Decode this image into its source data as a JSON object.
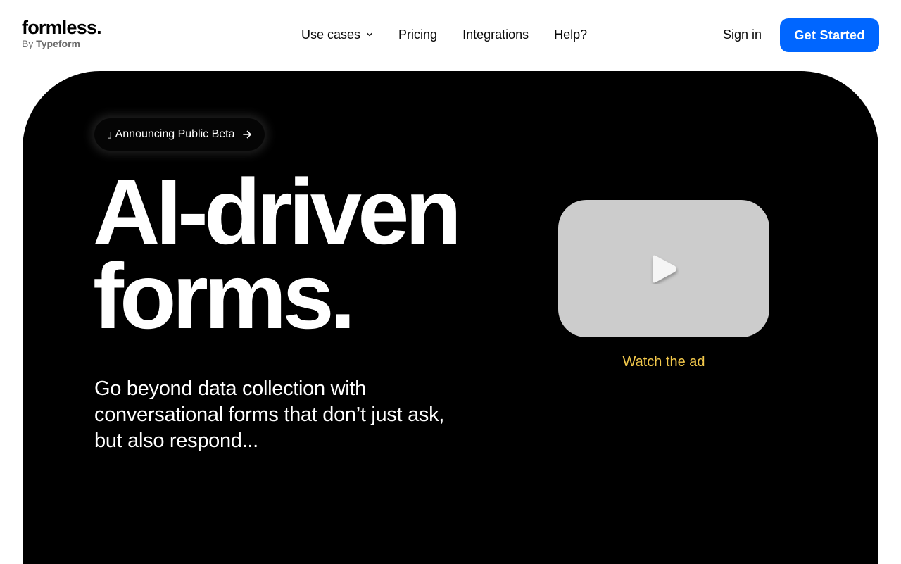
{
  "header": {
    "logo": {
      "wordmark": "formless.",
      "by_prefix": "By",
      "by_brand": "Typeform"
    },
    "nav": [
      {
        "label": "Use cases",
        "has_dropdown": true
      },
      {
        "label": "Pricing"
      },
      {
        "label": "Integrations"
      },
      {
        "label": "Help?"
      }
    ],
    "sign_in_label": "Sign in",
    "cta_label": "Get Started"
  },
  "hero": {
    "announcement": {
      "icon": "sparkle-icon",
      "label": "Announcing Public Beta"
    },
    "headline_line1": "AI-driven",
    "headline_line2": "forms.",
    "subtext": "Go beyond data collection with conversational forms that don’t just ask, but also respond...",
    "video": {
      "icon": "play-icon"
    },
    "watch_label": "Watch the ad"
  },
  "colors": {
    "accent": "#0066ff",
    "hero_bg": "#000000",
    "watch_link": "#f2c84b",
    "video_placeholder": "#cccccc"
  }
}
